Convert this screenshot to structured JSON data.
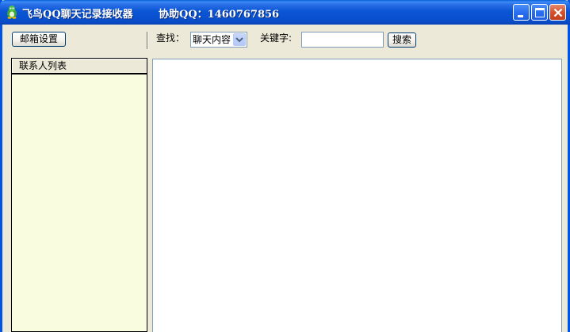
{
  "window": {
    "title": "飞鸟QQ聊天记录接收器",
    "assist": "协助QQ：1460767856"
  },
  "toolbar": {
    "email_settings_label": "邮箱设置",
    "find_label": "查找：",
    "find_select_value": "聊天内容",
    "keyword_label": "关键字:",
    "keyword_value": "",
    "search_label": "搜索"
  },
  "contacts": {
    "header": "联系人列表",
    "items": []
  },
  "icons": {
    "app": "qq-penguin-icon",
    "minimize": "minimize-icon",
    "maximize": "maximize-icon",
    "close": "close-icon",
    "dropdown": "chevron-down-icon"
  },
  "colors": {
    "titlebar": "#0a4bc4",
    "window_bg": "#ece9d8",
    "contact_list_bg": "#fafce0",
    "content_bg": "#ffffff",
    "close_button": "#d6512c"
  }
}
